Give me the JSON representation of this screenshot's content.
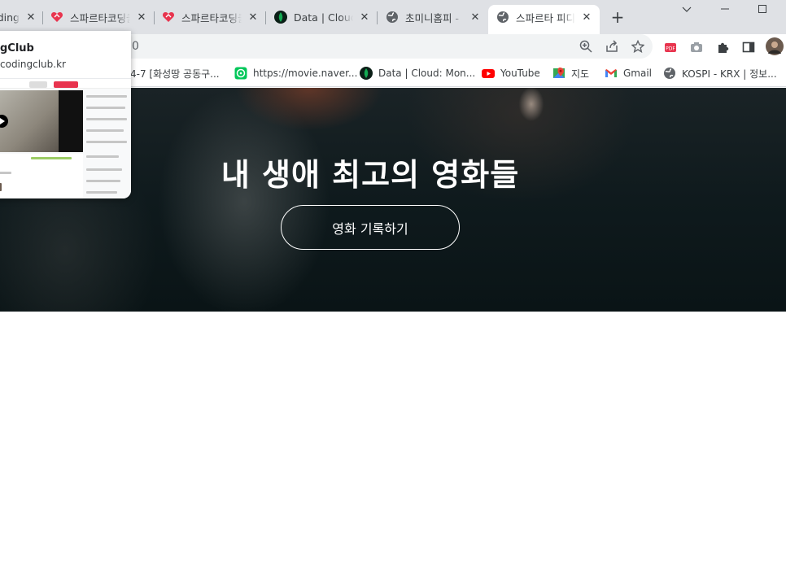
{
  "browser": {
    "tabs": [
      {
        "title": "SpartaCoding",
        "favicon": "generic"
      },
      {
        "title": "스파르타코딩클럽",
        "favicon": "sparta-heart-icon"
      },
      {
        "title": "스파르타코딩클럽",
        "favicon": "sparta-heart-icon"
      },
      {
        "title": "Data | Cloud: MongoDB",
        "favicon": "mongodb-leaf-icon"
      },
      {
        "title": "초미니홈피 - ",
        "favicon": "globe-icon"
      },
      {
        "title": "스파르타 피디아",
        "favicon": "globe-icon",
        "active": true
      }
    ],
    "new_tab_label": "+",
    "window_controls": {
      "minimize": "—",
      "maximize": "☐",
      "close": "✕",
      "tab_search": "⌄"
    }
  },
  "toolbar": {
    "url_fragment": "0"
  },
  "bookmarks": [
    {
      "label": "4-7 [화성땅 공동구...",
      "favicon": "none"
    },
    {
      "label": "https://movie.naver...",
      "favicon": "naver-movie-icon"
    },
    {
      "label": "Data | Cloud: Mon...",
      "favicon": "mongodb-leaf-icon"
    },
    {
      "label": "YouTube",
      "favicon": "youtube-icon"
    },
    {
      "label": "지도",
      "favicon": "google-maps-icon"
    },
    {
      "label": "Gmail",
      "favicon": "gmail-icon"
    },
    {
      "label": "KOSPI - KRX | 정보...",
      "favicon": "globe-icon"
    }
  ],
  "hovercard": {
    "title": "gClub",
    "url": "codingclub.kr"
  },
  "hero": {
    "title": "내 생애 최고의 영화들",
    "button_label": "영화 기록하기"
  },
  "colors": {
    "tab_strip": "#dfe1e5",
    "omnibox": "#f1f3f4",
    "hero_dark": "#0f1a1d",
    "sparta_red": "#e8344e",
    "youtube_red": "#ff0000",
    "mongodb_green": "#13aa52"
  }
}
